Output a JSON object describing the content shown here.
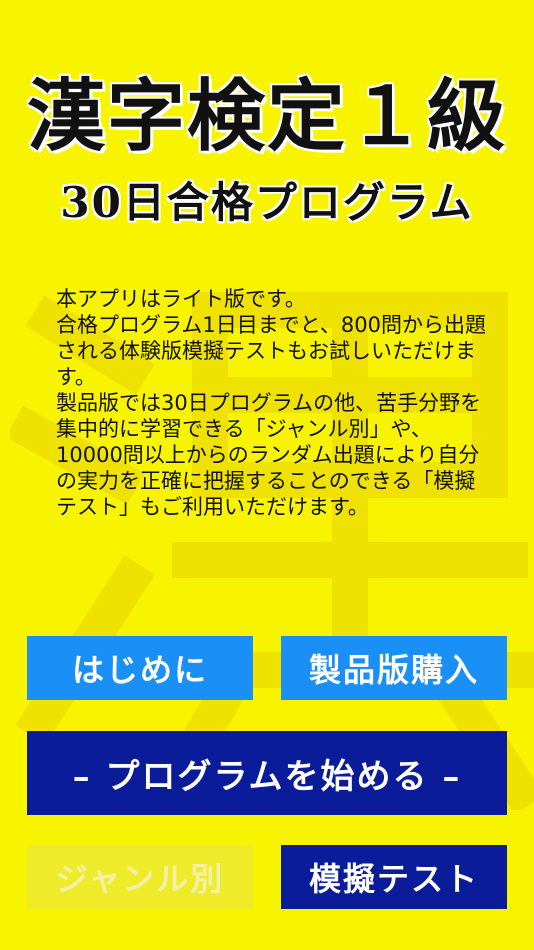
{
  "header": {
    "title": "漢字検定１級",
    "subtitle": "30日合格プログラム"
  },
  "description": "本アプリはライト版です。\n合格プログラム1日目までと、800問から出題される体験版模擬テストもお試しいただけます。\n製品版では30日プログラムの他、苦手分野を集中的に学習できる「ジャンル別」や、10000問以上からのランダム出題により自分の実力を正確に把握することのできる「模擬テスト」もご利用いただけます。",
  "buttons": {
    "intro": "はじめに",
    "buy": "製品版購入",
    "start": "– プログラムを始める –",
    "genre": "ジャンル別",
    "mock": "模擬テスト"
  },
  "colors": {
    "background": "#f8f400",
    "button_light": "#1a8ff5",
    "button_dark": "#0a1c9a",
    "button_disabled": "#eeeb2a"
  }
}
